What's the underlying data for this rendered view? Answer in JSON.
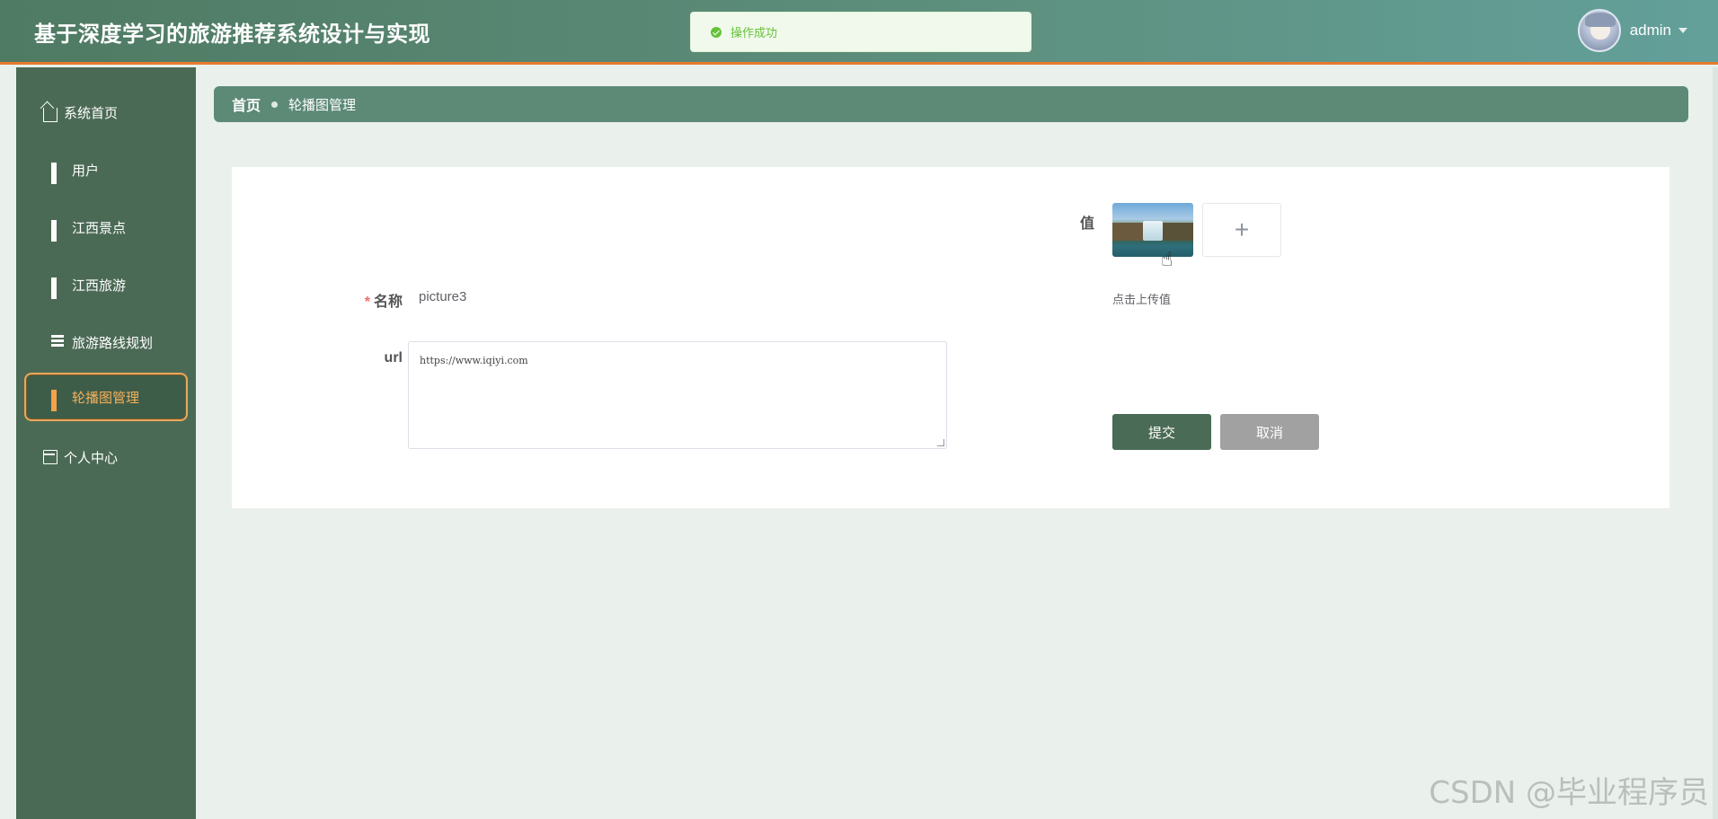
{
  "header": {
    "title": "基于深度学习的旅游推荐系统设计与实现",
    "toast": "操作成功",
    "username": "admin"
  },
  "sidebar": {
    "items": [
      {
        "label": "系统首页",
        "icon": "home-icon"
      },
      {
        "label": "用户",
        "icon": "grid-icon"
      },
      {
        "label": "江西景点",
        "icon": "grid-icon"
      },
      {
        "label": "江西旅游",
        "icon": "grid-icon"
      },
      {
        "label": "旅游路线规划",
        "icon": "list-icon"
      },
      {
        "label": "轮播图管理",
        "icon": "grid-icon",
        "active": true
      },
      {
        "label": "个人中心",
        "icon": "card-icon"
      }
    ]
  },
  "breadcrumb": {
    "home": "首页",
    "current": "轮播图管理"
  },
  "form": {
    "name_label": "名称",
    "name_value": "picture3",
    "url_label": "url",
    "url_value": "https://www.iqiyi.com",
    "value_label": "值",
    "upload_tip": "点击上传值",
    "upload_plus": "+",
    "submit_label": "提交",
    "cancel_label": "取消"
  },
  "watermark": "CSDN @毕业程序员",
  "colors": {
    "header_start": "#4f7a63",
    "header_end": "#63a09a",
    "sidebar_bg": "#4b6a55",
    "active_accent": "#f5a24a",
    "submit_bg": "#4a6b55",
    "cancel_bg": "#a1a1a1",
    "success": "#67c23a"
  }
}
